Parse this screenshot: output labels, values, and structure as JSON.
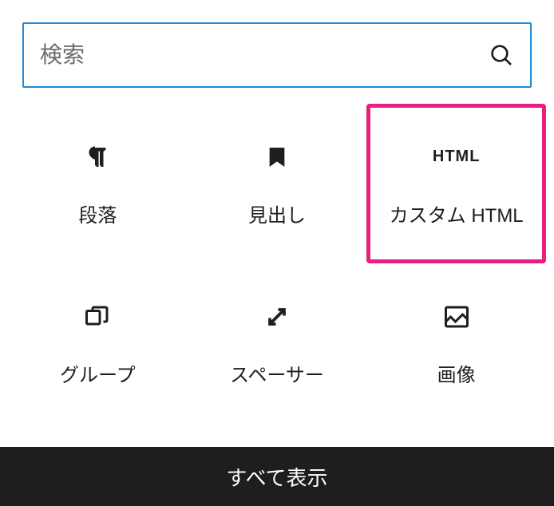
{
  "search": {
    "placeholder": "検索"
  },
  "blocks": [
    {
      "label": "段落",
      "icon": "paragraph",
      "highlighted": false
    },
    {
      "label": "見出し",
      "icon": "heading",
      "highlighted": false
    },
    {
      "label": "カスタム HTML",
      "icon": "html",
      "highlighted": true
    },
    {
      "label": "グループ",
      "icon": "group",
      "highlighted": false
    },
    {
      "label": "スペーサー",
      "icon": "spacer",
      "highlighted": false
    },
    {
      "label": "画像",
      "icon": "image",
      "highlighted": false
    }
  ],
  "htmlIconText": "HTML",
  "footer": {
    "showAll": "すべて表示"
  },
  "colors": {
    "highlight": "#e91e7e",
    "searchBorder": "#1a8cd8"
  }
}
